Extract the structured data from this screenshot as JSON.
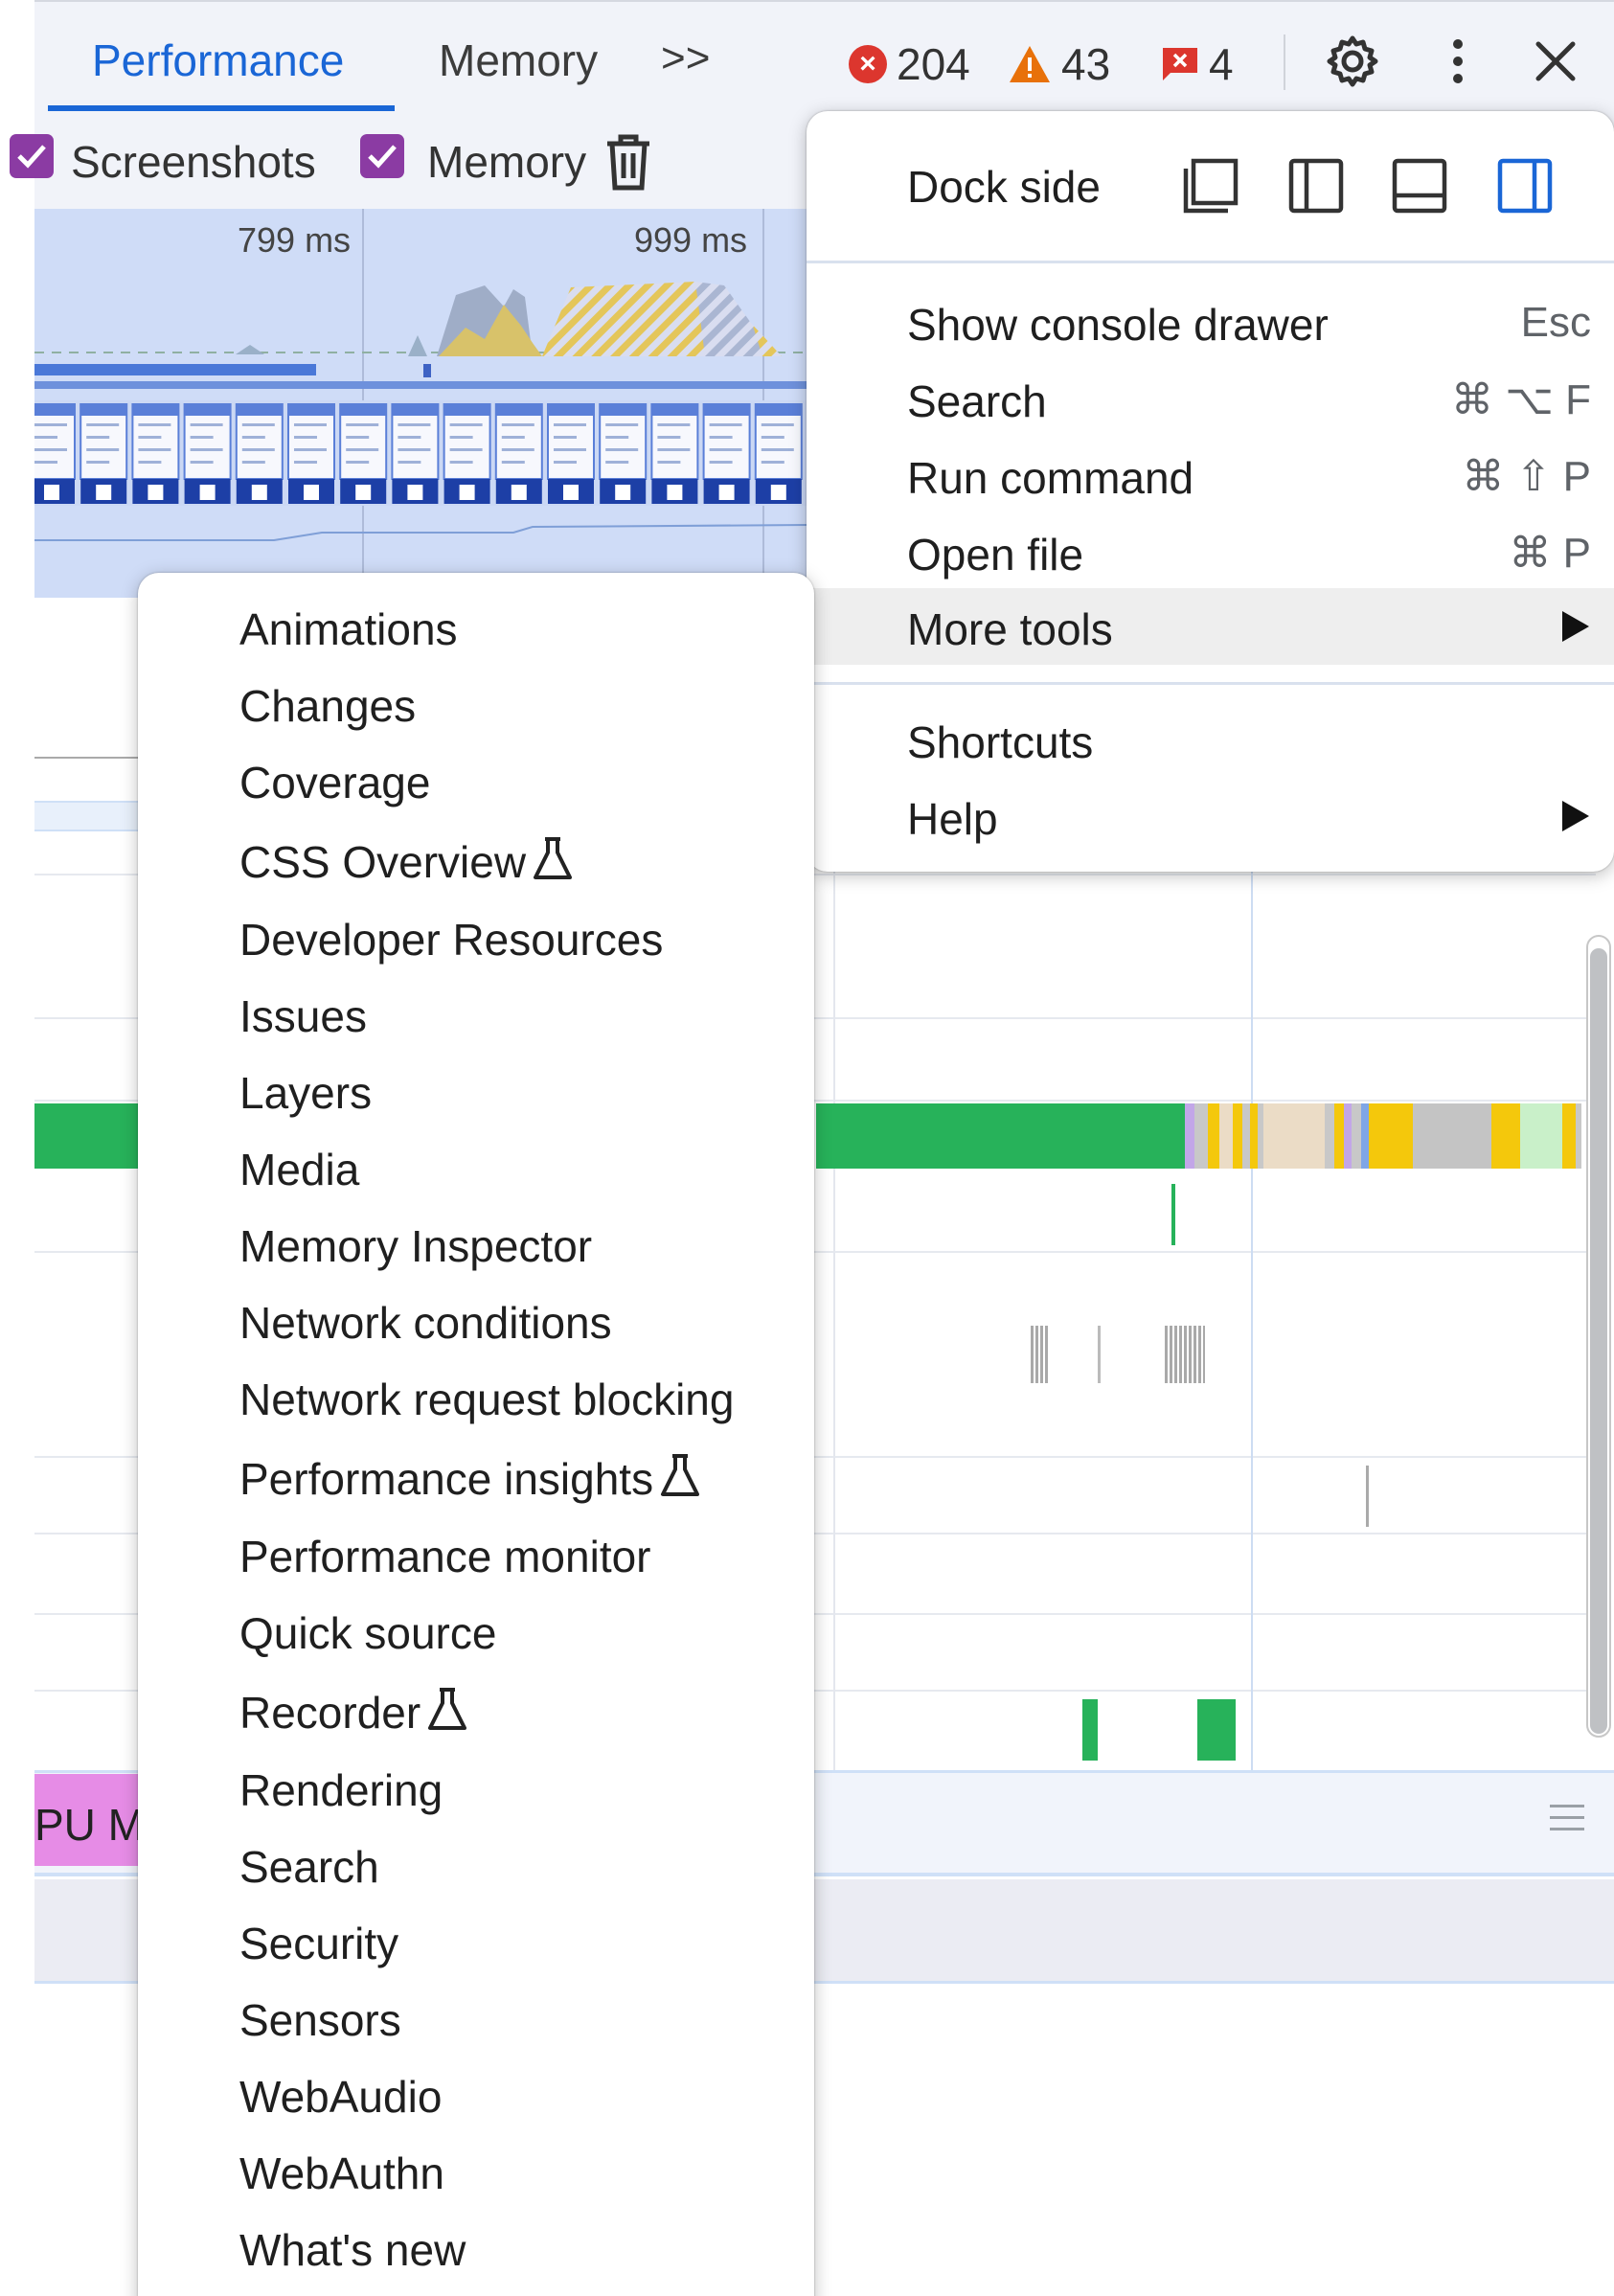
{
  "tabs": {
    "performance": "Performance",
    "memory": "Memory",
    "overflow_glyph": ">>"
  },
  "status": {
    "errors": "204",
    "warnings": "43",
    "issues": "4"
  },
  "toolbar": {
    "screenshots": "Screenshots",
    "memory": "Memory"
  },
  "overview": {
    "marker1": "799 ms",
    "marker2": "999 ms"
  },
  "bottom_panel": {
    "gpu_label": "PU M"
  },
  "main_menu": {
    "dock_side": "Dock side",
    "items": [
      {
        "label": "Show console drawer",
        "shortcut": "Esc"
      },
      {
        "label": "Search",
        "shortcut": "⌘ ⌥ F"
      },
      {
        "label": "Run command",
        "shortcut": "⌘ ⇧ P"
      },
      {
        "label": "Open file",
        "shortcut": "⌘ P"
      },
      {
        "label": "More tools"
      },
      {
        "label": "Shortcuts"
      },
      {
        "label": "Help"
      }
    ]
  },
  "more_tools": {
    "items": [
      "Animations",
      "Changes",
      "Coverage",
      "CSS Overview",
      "Developer Resources",
      "Issues",
      "Layers",
      "Media",
      "Memory Inspector",
      "Network conditions",
      "Network request blocking",
      "Performance insights",
      "Performance monitor",
      "Quick source",
      "Recorder",
      "Rendering",
      "Search",
      "Security",
      "Sensors",
      "WebAudio",
      "WebAuthn",
      "What's new"
    ]
  },
  "colors": {
    "accent": "#1a66d6",
    "checkbox": "#8b3ba3",
    "error": "#dc362e",
    "warning": "#e8710a",
    "main_thread": "#27b25a"
  }
}
